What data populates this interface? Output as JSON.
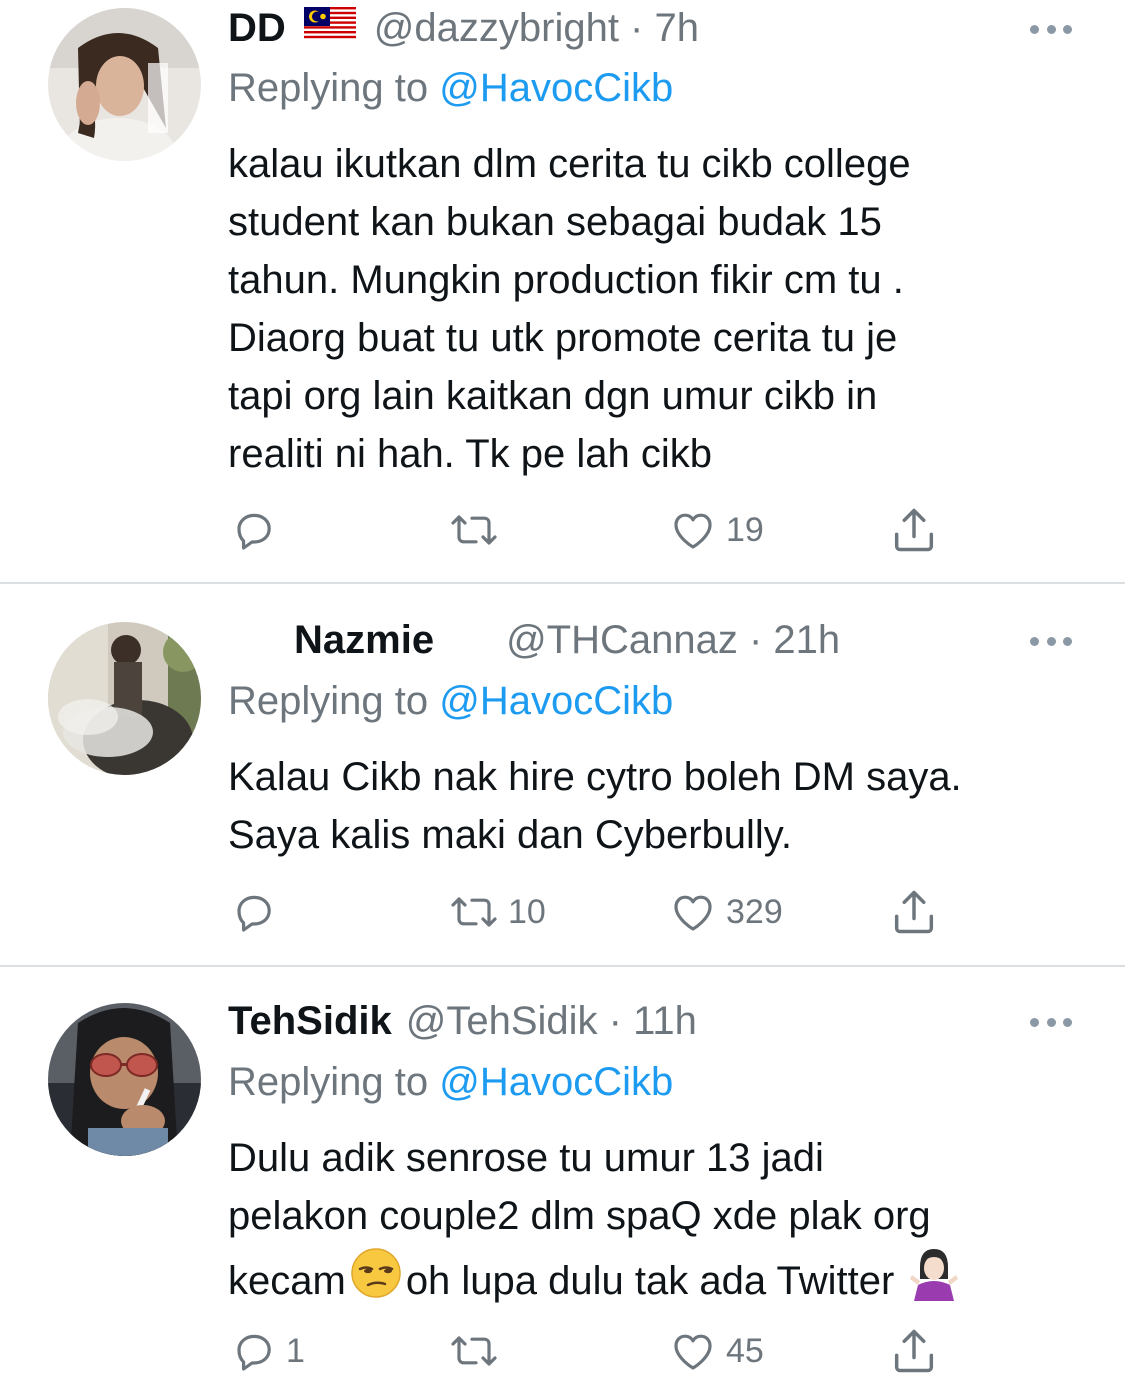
{
  "tweets": [
    {
      "name": "DD",
      "flag": "malaysia-flag",
      "handle": "@dazzybright",
      "time": "7h",
      "replying_prefix": "Replying to",
      "replying_to": "@HavocCikb",
      "body_lines": [
        "kalau ikutkan dlm cerita tu cikb college",
        "student kan bukan sebagai budak 15",
        "tahun. Mungkin production fikir cm tu .",
        "Diaorg buat tu utk promote cerita tu je",
        "tapi org lain kaitkan dgn umur cikb in",
        "realiti ni hah. Tk pe lah cikb"
      ],
      "reply_count": "",
      "retweet_count": "",
      "like_count": "19"
    },
    {
      "name": "Nazmie",
      "handle": "@THCannaz",
      "time": "21h",
      "replying_prefix": "Replying to",
      "replying_to": "@HavocCikb",
      "body_lines": [
        "Kalau Cikb nak hire cytro boleh DM saya.",
        "Saya kalis maki dan Cyberbully."
      ],
      "reply_count": "",
      "retweet_count": "10",
      "like_count": "329"
    },
    {
      "name": "TehSidik",
      "handle": "@TehSidik",
      "time": "11h",
      "replying_prefix": "Replying to",
      "replying_to": "@HavocCikb",
      "body_lines": [
        "Dulu adik senrose tu umur 13 jadi",
        "pelakon couple2 dlm spaQ xde plak org"
      ],
      "body_line3_a": "kecam",
      "body_line3_b": "oh lupa dulu tak ada Twitter",
      "emoji_1": "unamused-face-emoji",
      "emoji_2": "person-shrugging-emoji",
      "reply_count": "1",
      "retweet_count": "",
      "like_count": "45"
    }
  ],
  "colors": {
    "text": "#0f1419",
    "secondary": "#6e767d",
    "link": "#1d9bf0",
    "divider": "#dcdfe2"
  }
}
